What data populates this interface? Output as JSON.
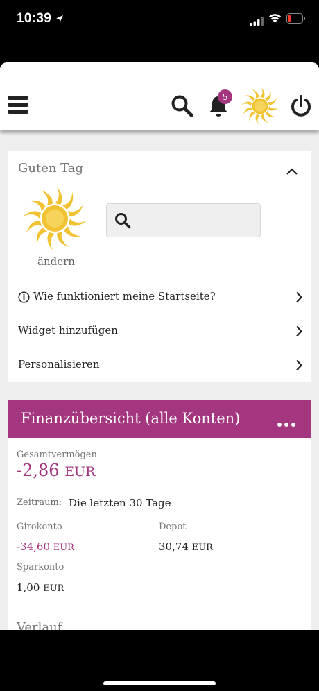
{
  "status_bar": {
    "time": "10:39",
    "icons": [
      "location-arrow-icon",
      "signal-icon",
      "wifi-icon",
      "battery-low-icon"
    ],
    "battery_color": "#ff3b30"
  },
  "header": {
    "icons": [
      "menu-icon",
      "search-icon",
      "bell-icon",
      "sun-logo-icon",
      "power-icon"
    ],
    "notification_count": "5",
    "badge_color": "#a3367f"
  },
  "greeting_card": {
    "title": "Guten Tag",
    "avatar_caption": "ändern",
    "search_placeholder": "",
    "rows": [
      {
        "label": "Wie funktioniert meine Startseite?",
        "icon": "info-icon"
      },
      {
        "label": "Widget hinzufügen"
      },
      {
        "label": "Personalisieren"
      }
    ]
  },
  "finance_card": {
    "title": "Finanzübersicht (alle Konten)",
    "header_color": "#a3367f",
    "total_label": "Gesamtvermögen",
    "total_amount": "-2,86",
    "total_currency": "EUR",
    "period_label": "Zeitraum:",
    "period_value": "Die letzten 30 Tage",
    "accounts": [
      {
        "name": "Girokonto",
        "amount": "-34,60",
        "currency": "EUR"
      },
      {
        "name": "Depot",
        "amount": "30,74",
        "currency": "EUR"
      },
      {
        "name": "Sparkonto",
        "amount": "1,00",
        "currency": "EUR"
      }
    ],
    "next_section": "Verlauf"
  }
}
